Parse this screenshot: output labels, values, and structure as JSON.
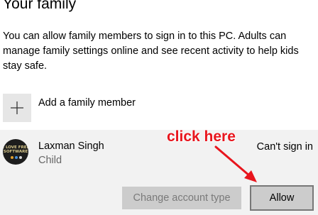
{
  "page": {
    "title": "Your family",
    "description": "You can allow family members to sign in to this PC. Adults can manage family settings online and see recent activity to help kids stay safe."
  },
  "add_member": {
    "label": "Add a family member",
    "icon": "plus-icon"
  },
  "member": {
    "name": "Laxman Singh",
    "role": "Child",
    "status": "Can't sign in",
    "avatar_text": "I LOVE FREE\nSOFTWARE",
    "change_account_type_label": "Change account type",
    "allow_label": "Allow"
  },
  "annotation": {
    "text": "click here",
    "color": "#e8151d"
  },
  "colors": {
    "panel_background": "#f2f2f2",
    "button_background": "#cccccc",
    "disabled_text": "#7a7a7a"
  }
}
